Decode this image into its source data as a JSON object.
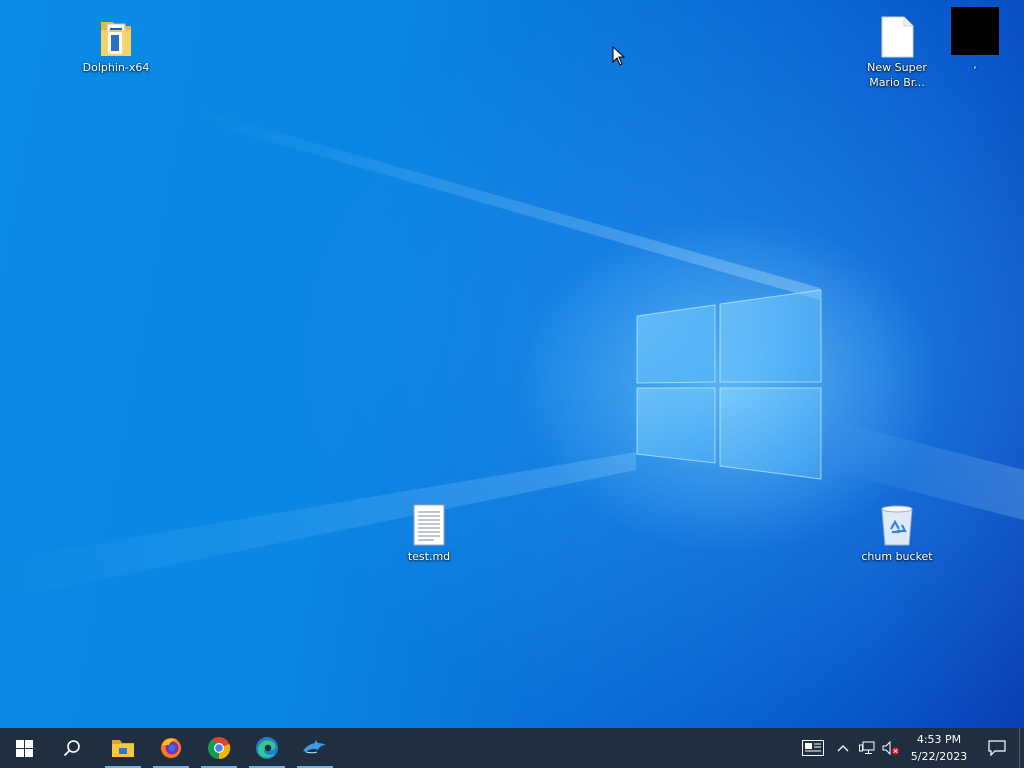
{
  "desktop": {
    "icons": [
      {
        "label": "Dolphin-x64",
        "icon": "folder-icon"
      },
      {
        "label": "New Super\nMario Br...",
        "icon": "blank-file-icon"
      },
      {
        "label": ",",
        "icon": "black-thumbnail-icon"
      },
      {
        "label": "test.md",
        "icon": "text-document-icon"
      },
      {
        "label": "chum bucket",
        "icon": "recycle-bin-icon"
      }
    ]
  },
  "taskbar": {
    "start": "windows-start-icon",
    "search": "search-icon",
    "pinned": [
      {
        "app": "File Explorer",
        "icon": "file-explorer-icon",
        "active": true
      },
      {
        "app": "Firefox",
        "icon": "firefox-icon",
        "active": true
      },
      {
        "app": "Chrome",
        "icon": "chrome-icon",
        "active": true
      },
      {
        "app": "Edge",
        "icon": "edge-icon",
        "active": true
      },
      {
        "app": "Dolphin",
        "icon": "dolphin-icon",
        "active": true
      }
    ],
    "tray": {
      "time": "4:53 PM",
      "date": "5/22/2023"
    }
  },
  "colors": {
    "taskbar_bg": "#1f2f40",
    "accent_underline": "#6fb2e8",
    "wallpaper_blue": "#0a86e3"
  }
}
